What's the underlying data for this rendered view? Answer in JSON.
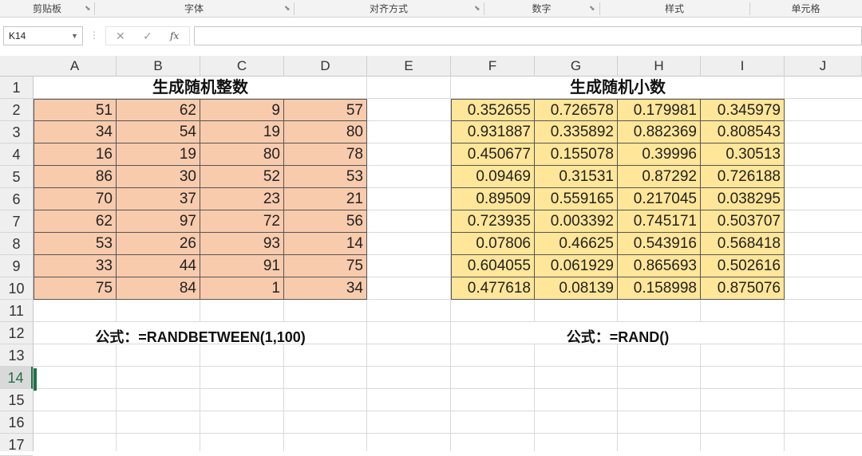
{
  "ribbon": {
    "groups": [
      "剪贴板",
      "字体",
      "对齐方式",
      "数字",
      "样式",
      "单元格"
    ]
  },
  "formula_bar": {
    "name_box": "K14",
    "cancel_icon": "✕",
    "enter_icon": "✓",
    "fx_label": "fx",
    "formula_value": ""
  },
  "columns": [
    "A",
    "B",
    "C",
    "D",
    "E",
    "F",
    "G",
    "H",
    "I",
    "J"
  ],
  "rows": [
    "1",
    "2",
    "3",
    "4",
    "5",
    "6",
    "7",
    "8",
    "9",
    "10",
    "11",
    "12",
    "13",
    "14",
    "15",
    "16",
    "17"
  ],
  "selected_cell": "K14",
  "sheet": {
    "int_title": "生成随机整数",
    "dec_title": "生成随机小数",
    "int_formula": "公式：=RANDBETWEEN(1,100)",
    "dec_formula": "公式：=RAND()",
    "int_values": [
      [
        "51",
        "62",
        "9",
        "57"
      ],
      [
        "34",
        "54",
        "19",
        "80"
      ],
      [
        "16",
        "19",
        "80",
        "78"
      ],
      [
        "86",
        "30",
        "52",
        "53"
      ],
      [
        "70",
        "37",
        "23",
        "21"
      ],
      [
        "62",
        "97",
        "72",
        "56"
      ],
      [
        "53",
        "26",
        "93",
        "14"
      ],
      [
        "33",
        "44",
        "91",
        "75"
      ],
      [
        "75",
        "84",
        "1",
        "34"
      ]
    ],
    "dec_values": [
      [
        "0.352655",
        "0.726578",
        "0.179981",
        "0.345979"
      ],
      [
        "0.931887",
        "0.335892",
        "0.882369",
        "0.808543"
      ],
      [
        "0.450677",
        "0.155078",
        "0.39996",
        "0.30513"
      ],
      [
        "0.09469",
        "0.31531",
        "0.87292",
        "0.726188"
      ],
      [
        "0.89509",
        "0.559165",
        "0.217045",
        "0.038295"
      ],
      [
        "0.723935",
        "0.003392",
        "0.745171",
        "0.503707"
      ],
      [
        "0.07806",
        "0.46625",
        "0.543916",
        "0.568418"
      ],
      [
        "0.604055",
        "0.061929",
        "0.865693",
        "0.502616"
      ],
      [
        "0.477618",
        "0.08139",
        "0.158998",
        "0.875076"
      ]
    ]
  },
  "colors": {
    "int_fill": "#f8cbad",
    "dec_fill": "#ffe699",
    "select_accent": "#1e7145"
  }
}
